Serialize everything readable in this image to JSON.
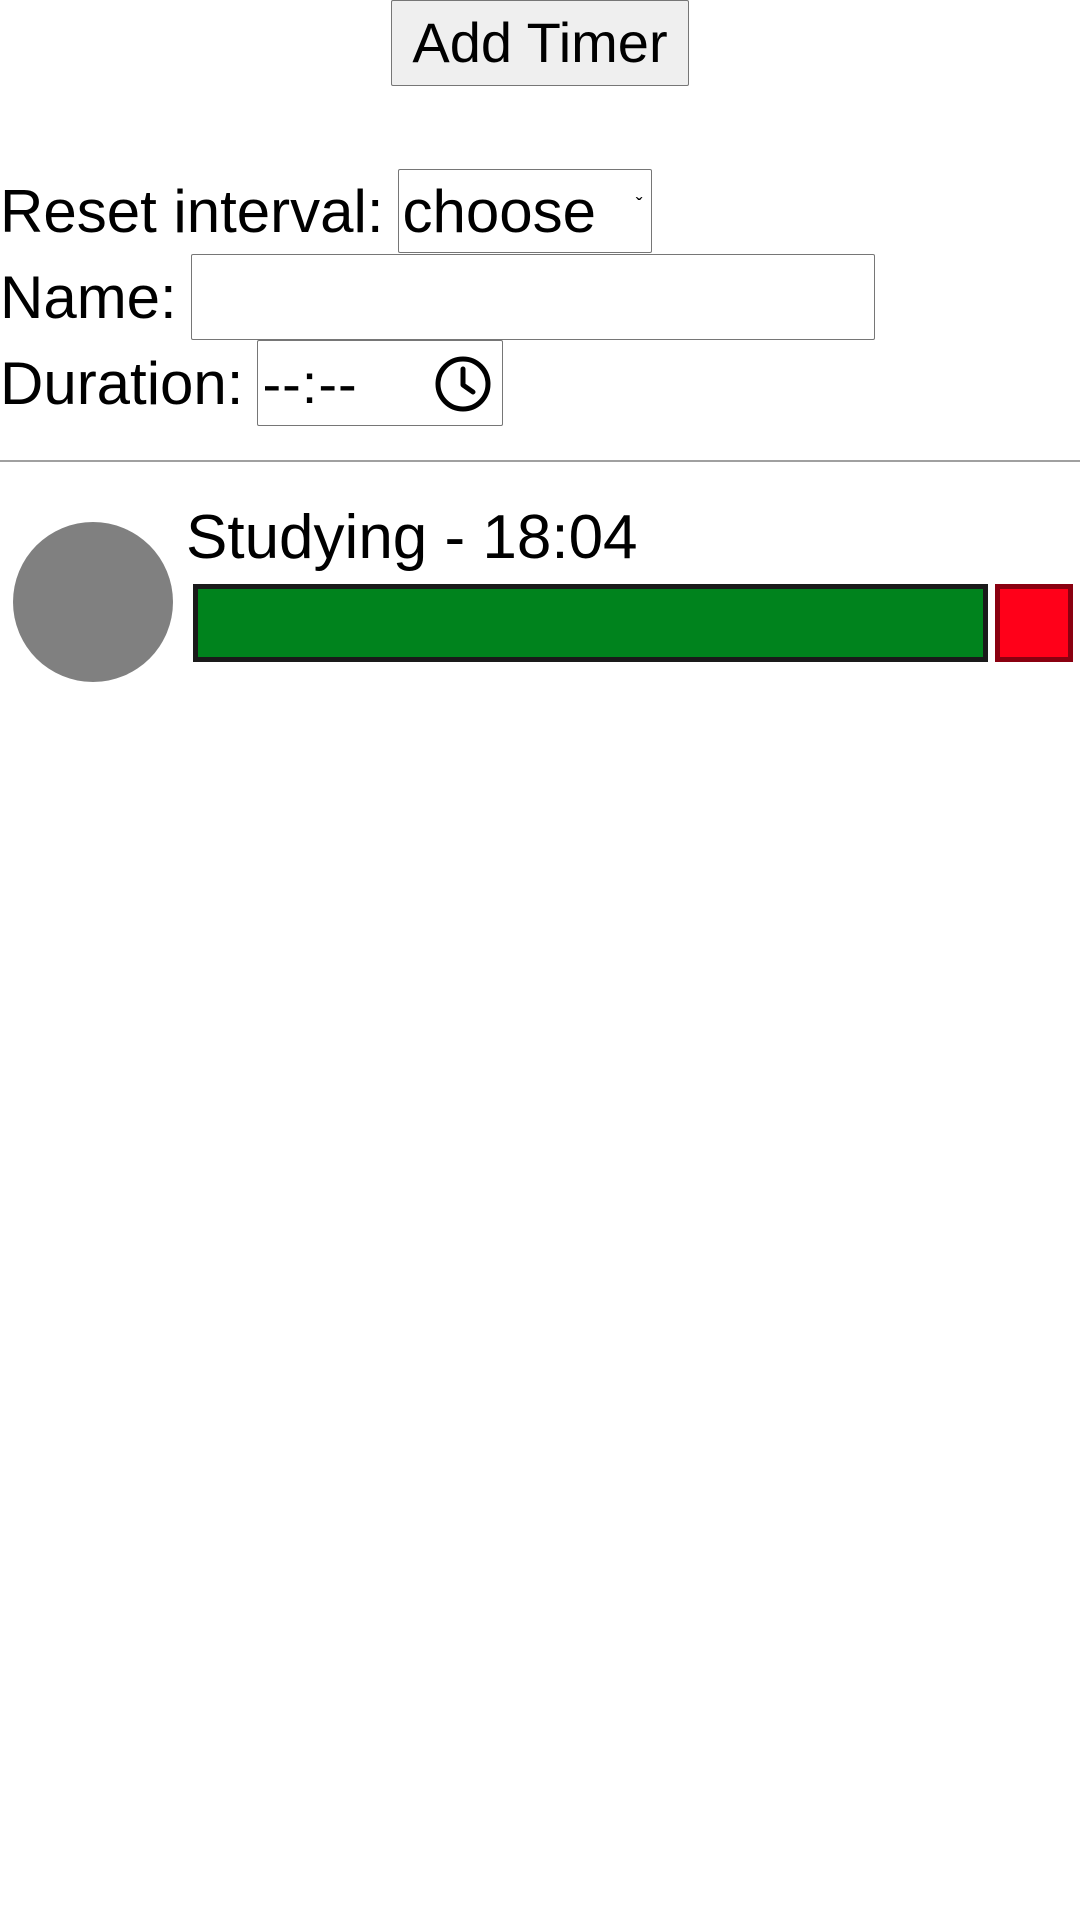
{
  "add_timer": {
    "label": "Add Timer"
  },
  "form": {
    "reset_interval": {
      "label": "Reset interval:",
      "value": "choose"
    },
    "name": {
      "label": "Name:",
      "value": "",
      "placeholder": ""
    },
    "duration": {
      "label": "Duration:",
      "value": "--:--",
      "icon": "clock-icon"
    }
  },
  "timers": [
    {
      "title": "Studying - 18:04",
      "progress_fraction": 1.0,
      "progress_color": "#00831d",
      "stop_color": "#ff0019",
      "avatar_color": "#808080"
    }
  ]
}
